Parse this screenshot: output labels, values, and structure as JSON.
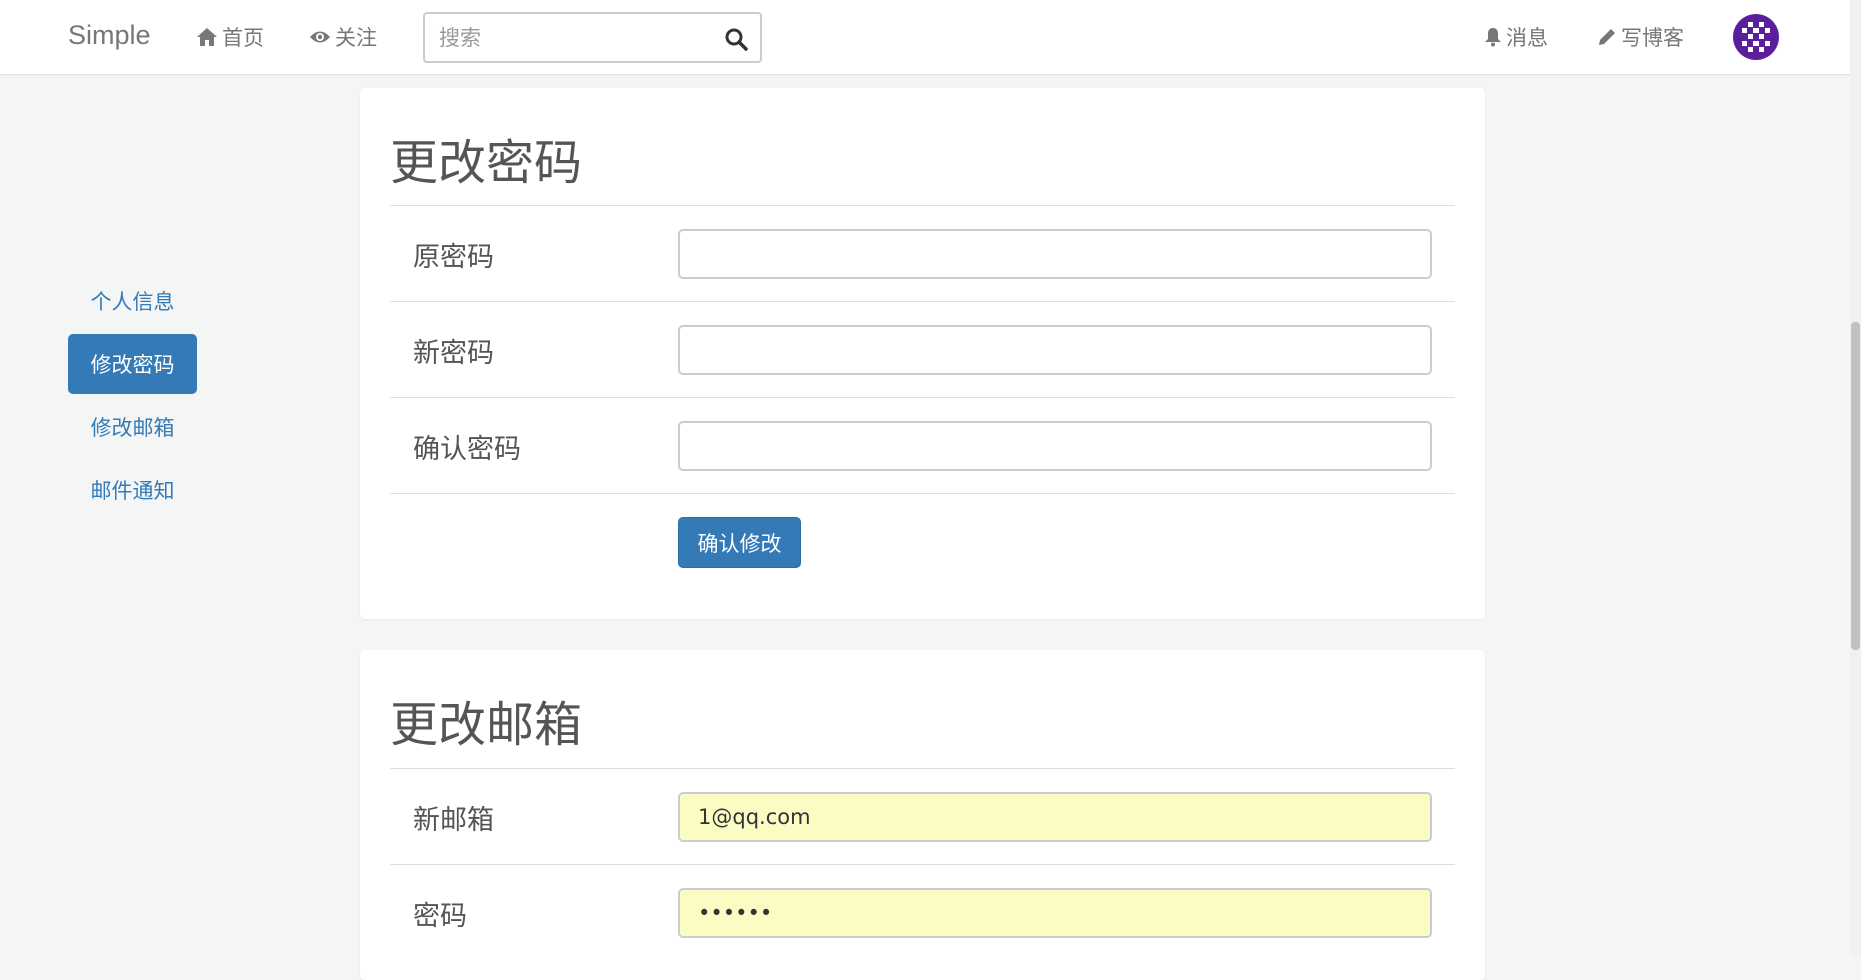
{
  "navbar": {
    "brand": "Simple",
    "home_label": "首页",
    "follow_label": "关注",
    "search_placeholder": "搜索",
    "messages_label": "消息",
    "write_label": "写博客"
  },
  "sidebar": {
    "items": [
      {
        "label": "个人信息",
        "active": false
      },
      {
        "label": "修改密码",
        "active": true
      },
      {
        "label": "修改邮箱",
        "active": false
      },
      {
        "label": "邮件通知",
        "active": false
      }
    ]
  },
  "password_panel": {
    "title": "更改密码",
    "fields": [
      {
        "label": "原密码",
        "value": ""
      },
      {
        "label": "新密码",
        "value": ""
      },
      {
        "label": "确认密码",
        "value": ""
      }
    ],
    "submit_label": "确认修改"
  },
  "email_panel": {
    "title": "更改邮箱",
    "fields": [
      {
        "label": "新邮箱",
        "value": "1@qq.com"
      },
      {
        "label": "密码",
        "value": "••••••"
      }
    ]
  },
  "colors": {
    "primary": "#337ab7",
    "autofill": "#fafcc3",
    "avatar": "#5b1f9e"
  }
}
